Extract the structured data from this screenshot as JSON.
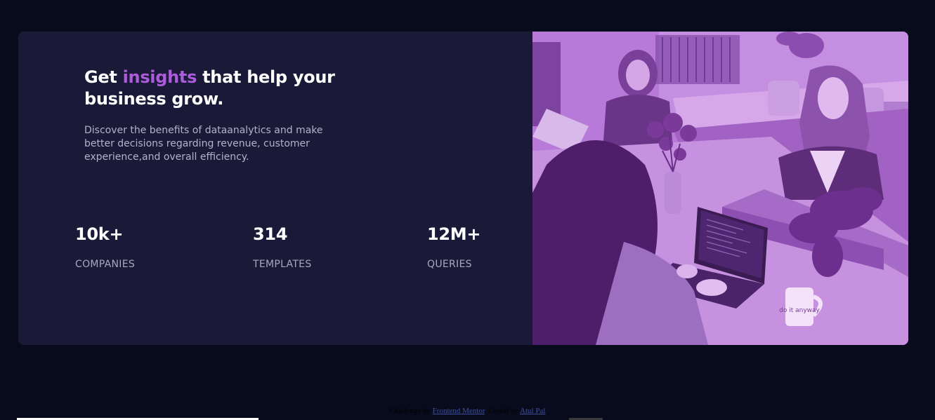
{
  "hero": {
    "title_start": "Get ",
    "title_accent": "insights",
    "title_end": " that help your business grow.",
    "description": "Discover the benefits of dataanalytics and make better decisions regarding revenue, customer experience,and overall efficiency."
  },
  "stats": [
    {
      "value": "10k+",
      "label": "COMPANIES"
    },
    {
      "value": "314",
      "label": "TEMPLATES"
    },
    {
      "value": "12M+",
      "label": "QUERIES"
    }
  ],
  "attribution": {
    "prefix": "Challenge by ",
    "link1": "Frontend Mentor",
    "middle": ". Coded by ",
    "link2": "Atul Pal"
  },
  "colors": {
    "page_bg": "#080b1c",
    "card_bg": "#1b1938",
    "accent": "#ab5cdb",
    "image_overlay": "#a565c9"
  },
  "image": {
    "icon": "office-photo",
    "mug_text": "do it anyway"
  }
}
